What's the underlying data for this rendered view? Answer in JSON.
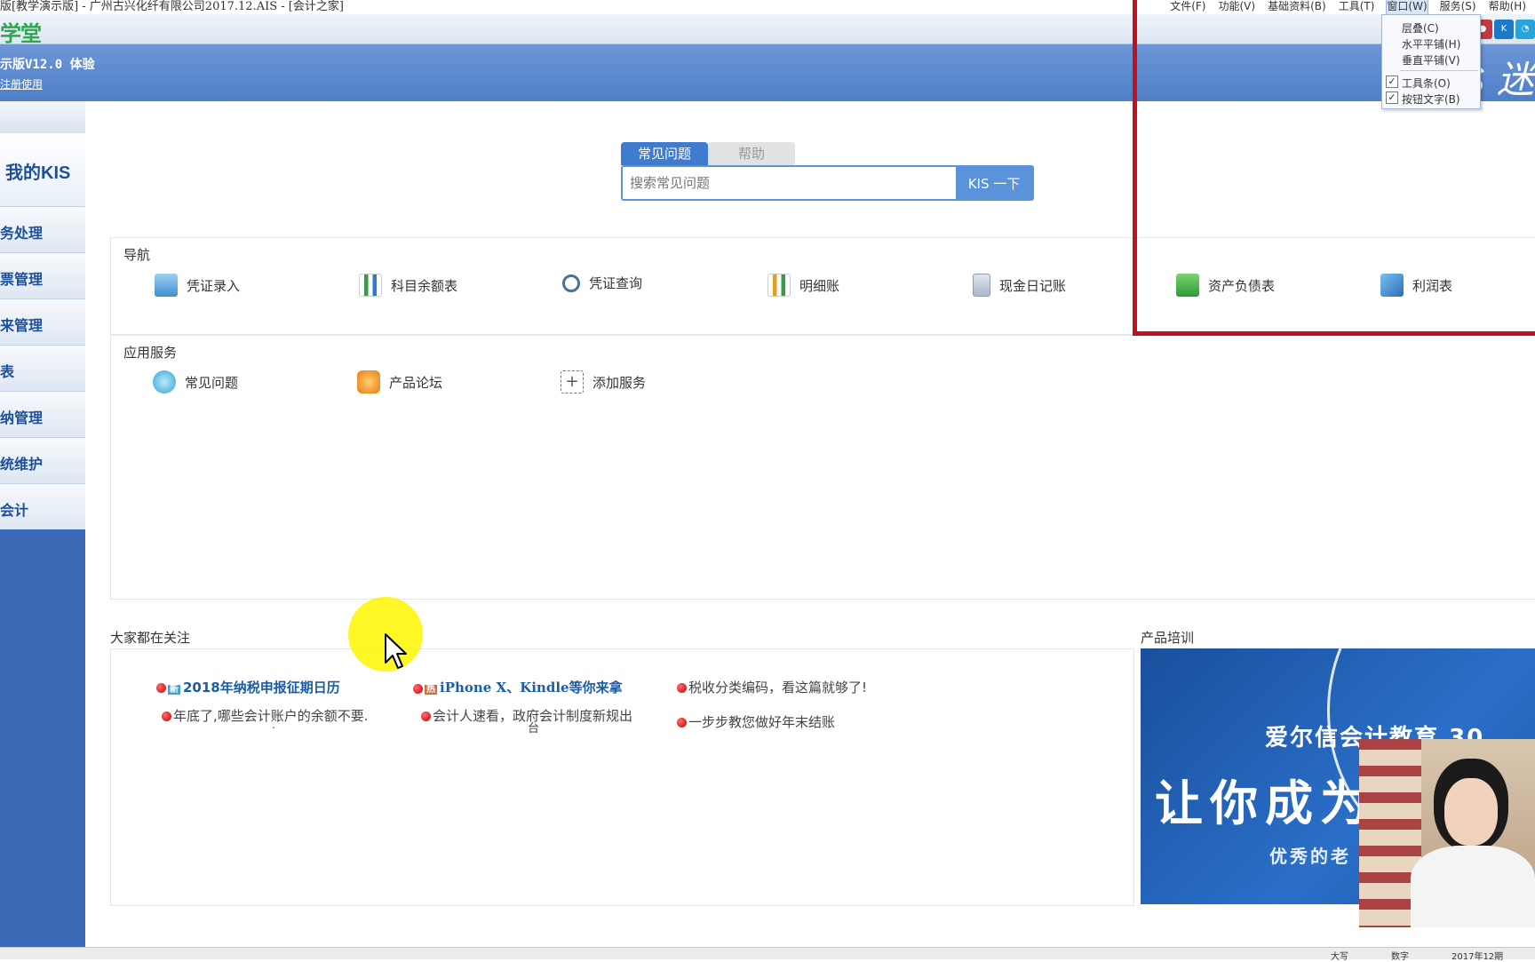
{
  "window": {
    "title": "版[教学演示版] - 广州古兴化纤有限公司2017.12.AIS - [会计之家]"
  },
  "menu": {
    "items": [
      "文件(F)",
      "功能(V)",
      "基础资料(B)",
      "工具(T)",
      "窗口(W)",
      "服务(S)",
      "帮助(H)"
    ],
    "active_index": 4
  },
  "window_menu": {
    "items": [
      "层叠(C)",
      "水平平铺(H)",
      "垂直平铺(V)"
    ],
    "checked_items": [
      "工具条(O)",
      "按钮文字(B)"
    ]
  },
  "toolbar": {
    "logo_text": "学堂"
  },
  "banner": {
    "version": "示版V12.0 体验",
    "register_link": "注册使用",
    "brand": "KIS 迷"
  },
  "sidebar": {
    "title": "我的KIS",
    "items": [
      "务处理",
      "票管理",
      "来管理",
      "表",
      "纳管理",
      "统维护",
      "会计"
    ]
  },
  "search": {
    "tabs": [
      "常见问题",
      "帮助"
    ],
    "active_tab": 0,
    "placeholder": "搜索常见问题",
    "button_label": "KIS 一下"
  },
  "navigation": {
    "title": "导航",
    "items": [
      {
        "label": "凭证录入",
        "icon": "voucher-entry-icon"
      },
      {
        "label": "科目余额表",
        "icon": "balance-sheet-chart-icon"
      },
      {
        "label": "凭证查询",
        "icon": "magnifier-icon"
      },
      {
        "label": "明细账",
        "icon": "ledger-chart-icon"
      },
      {
        "label": "现金日记账",
        "icon": "cash-journal-icon"
      },
      {
        "label": "资产负债表",
        "icon": "assets-liabilities-icon"
      },
      {
        "label": "利润表",
        "icon": "profit-cubes-icon"
      }
    ]
  },
  "services": {
    "title": "应用服务",
    "items": [
      {
        "label": "常见问题",
        "icon": "faq-icon"
      },
      {
        "label": "产品论坛",
        "icon": "forum-icon"
      },
      {
        "label": "添加服务",
        "icon": "add-service-icon"
      }
    ]
  },
  "news": {
    "title": "大家都在关注",
    "items": [
      {
        "badge": "新",
        "text": "2018年纳税申报征期日历",
        "highlight": true
      },
      {
        "badge": "热",
        "text": "iPhone X、Kindle等你来拿",
        "highlight": true
      },
      {
        "text": "税收分类编码，看这篇就够了!",
        "highlight": false
      },
      {
        "text": "年底了,哪些会计账户的余额不要.",
        "suffix": ".",
        "highlight": false
      },
      {
        "text": "会计人速看，政府会计制度新规出",
        "suffix": "台",
        "highlight": false
      },
      {
        "text": "一步步教您做好年末结账",
        "highlight": false
      }
    ]
  },
  "training": {
    "title": "产品培训",
    "banner_line1": "爱尔信会计教育",
    "banner_line1_tail": "30",
    "banner_line2": "让你成为",
    "banner_line3": "优秀的老"
  },
  "statusbar": {
    "items": [
      "大写",
      "数字",
      "2017年12期"
    ]
  },
  "colors": {
    "banner": "#5a87cd",
    "sidebar": "#3d6ab6",
    "accent": "#3f7ccf",
    "highlight_box": "#c0121e"
  }
}
